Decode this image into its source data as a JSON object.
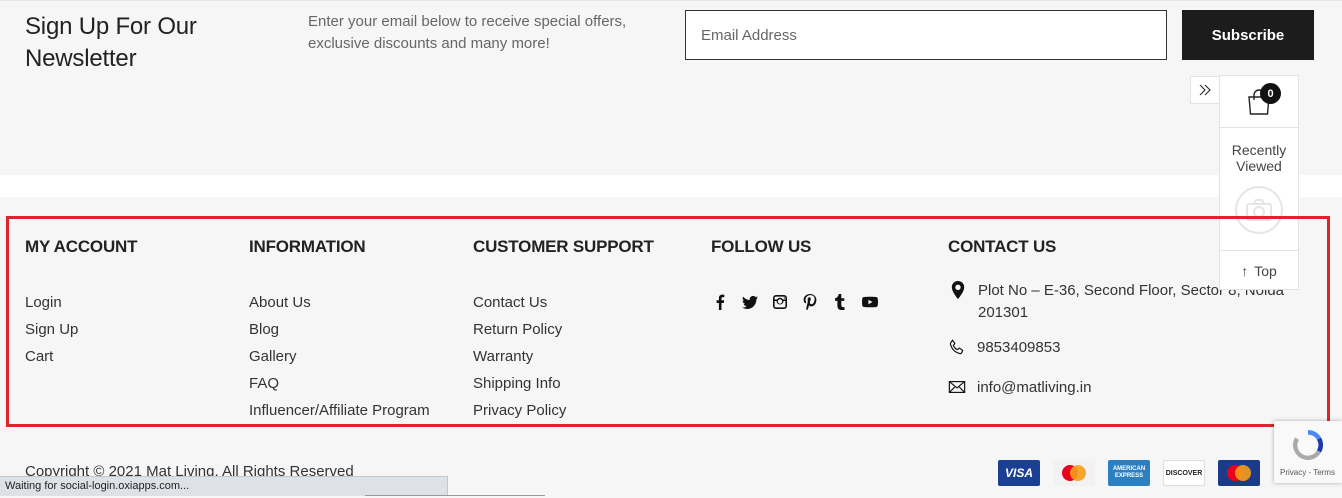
{
  "newsletter": {
    "title": "Sign Up For Our Newsletter",
    "text": "Enter your email below to receive special offers, exclusive discounts and many more!",
    "email_placeholder": "Email Address",
    "subscribe_label": "Subscribe"
  },
  "widget": {
    "cart_count": "0",
    "recently_viewed": "Recently Viewed",
    "top_label": "Top"
  },
  "footer": {
    "my_account": {
      "heading": "MY ACCOUNT",
      "links": [
        "Login",
        "Sign Up",
        "Cart"
      ]
    },
    "information": {
      "heading": "INFORMATION",
      "links": [
        "About Us",
        "Blog",
        "Gallery",
        "FAQ",
        "Influencer/Affiliate Program"
      ]
    },
    "customer_support": {
      "heading": "CUSTOMER SUPPORT",
      "links": [
        "Contact Us",
        "Return Policy",
        "Warranty",
        "Shipping Info",
        "Privacy Policy"
      ]
    },
    "follow_us": {
      "heading": "FOLLOW US",
      "icons": [
        "facebook-icon",
        "twitter-icon",
        "instagram-icon",
        "pinterest-icon",
        "tumblr-icon",
        "youtube-icon"
      ]
    },
    "contact_us": {
      "heading": "CONTACT US",
      "address_line1": "Plot No – E-36, Second Floor, Sector 8, Noida",
      "address_line2": "201301",
      "phone": "9853409853",
      "email": "info@matliving.in"
    },
    "copyright": "Copyright © 2021 Mat Living. All Rights Reserved",
    "payments": [
      "VISA",
      "MasterCard",
      "AMERICAN EXPRESS",
      "DISCOVER",
      "Maestro"
    ]
  },
  "recaptcha": {
    "text": "Privacy - Terms"
  },
  "status_bar": "Waiting for social-login.oxiapps.com...",
  "colors": {
    "highlight": "#e0242d",
    "button_bg": "#1c1c1c",
    "footer_bg": "#f6f6f6"
  }
}
